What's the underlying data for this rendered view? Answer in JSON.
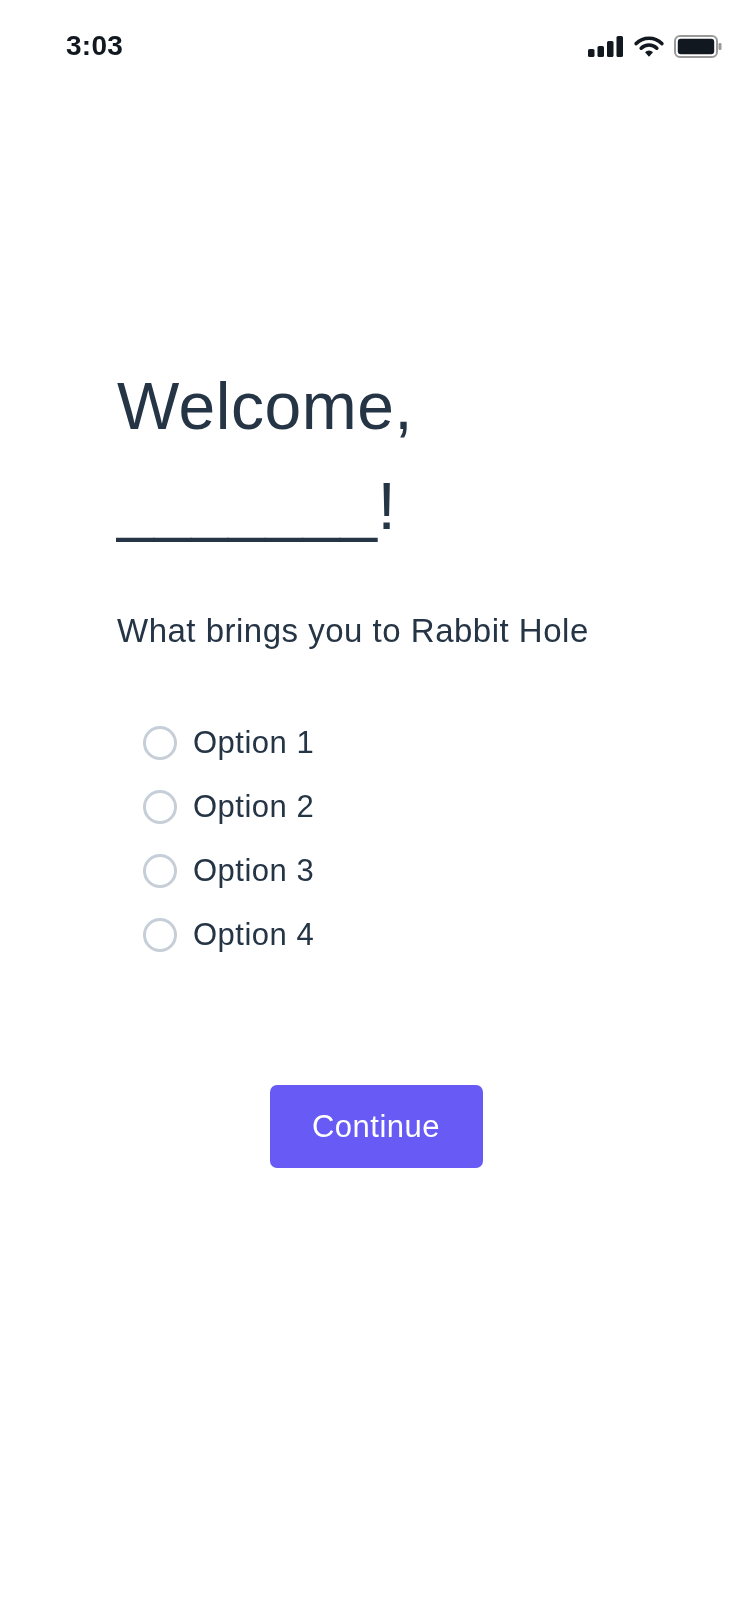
{
  "status_bar": {
    "time": "3:03"
  },
  "heading": "Welcome, _______!",
  "prompt": "What brings you to Rabbit Hole",
  "options": [
    {
      "label": "Option 1",
      "selected": false
    },
    {
      "label": "Option 2",
      "selected": false
    },
    {
      "label": "Option 3",
      "selected": false
    },
    {
      "label": "Option 4",
      "selected": false
    }
  ],
  "button": {
    "label": "Continue"
  }
}
